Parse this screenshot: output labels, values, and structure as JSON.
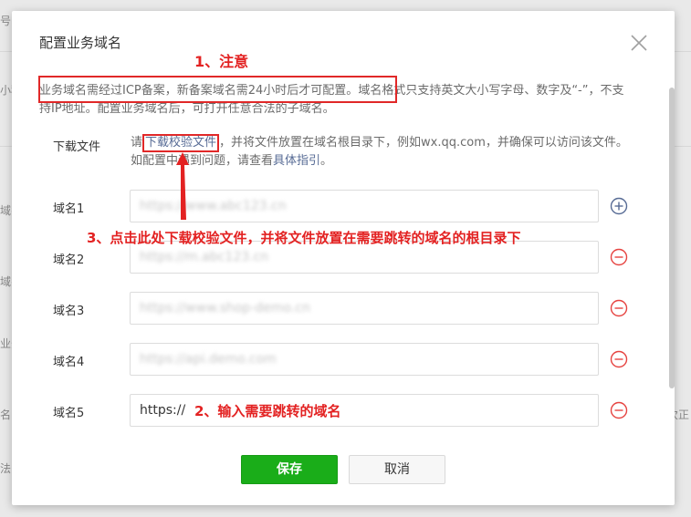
{
  "background": {
    "fragments_left": [
      "号ID",
      "小程",
      "域名",
      "域名",
      "业务",
      "名",
      "法"
    ],
    "fragment_right": "次正"
  },
  "dialog": {
    "title": "配置业务域名",
    "notice_part1": "业务域名需经过ICP备案，新备案域名需",
    "notice_part2": "24小时后才可配置。",
    "notice_part3": "域名格式只支持英文大小写字母、数字及“-”，不支持IP地址。配置业务域名后，可打开任意合法的子域名。",
    "download_label": "下载文件",
    "download_prefix": "请",
    "download_link": "下载校验文件",
    "download_middle": "，并将文件放置在域名根目录下，例如wx.qq.com，并确保可以访问该文件。如配置中遇到问题，请查看",
    "guide_link": "具体指引",
    "download_suffix": "。",
    "domains": [
      {
        "label": "域名1",
        "value": "https://www.abc123.cn"
      },
      {
        "label": "域名2",
        "value": "https://m.abc123.cn"
      },
      {
        "label": "域名3",
        "value": "https://www.shop-demo.cn"
      },
      {
        "label": "域名4",
        "value": "https://api.demo.com"
      },
      {
        "label": "域名5",
        "value": "https://"
      }
    ],
    "save_label": "保存",
    "cancel_label": "取消"
  },
  "annotations": {
    "note1": "1、注意",
    "note2": "2、输入需要跳转的域名",
    "note3": "3、点击此处下载校验文件，并将文件放置在需要跳转的域名的根目录下"
  },
  "colors": {
    "primary": "#1aad19",
    "link": "#576b95",
    "annotation": "#e12828",
    "add_icon": "#576b95",
    "remove_icon": "#e64340"
  },
  "icons": {
    "close": "close-icon",
    "add": "plus-circle-icon",
    "remove": "minus-circle-icon"
  }
}
